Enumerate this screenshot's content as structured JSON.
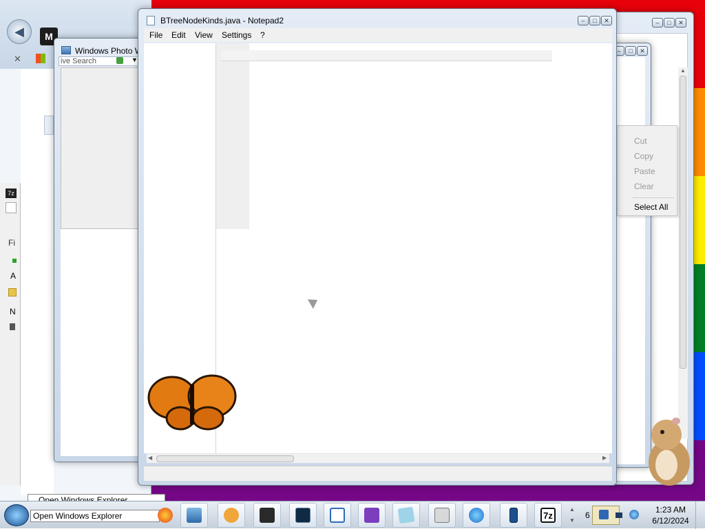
{
  "colors": {
    "wallpaper": [
      "#e8000b",
      "#ff8c00",
      "#ffed00",
      "#008026",
      "#004dff",
      "#750787"
    ],
    "notepad_frame": "#dfe8f3",
    "taskbar": "#d7dfe8"
  },
  "explorer_back_window": {
    "title": "Windows Photo W",
    "search_text": "ive Search"
  },
  "notepad": {
    "title": "BTreeNodeKinds.java - Notepad2",
    "menu": [
      "File",
      "Edit",
      "View",
      "Settings",
      "?"
    ],
    "toolbar_chevron": "»"
  },
  "context_menu": {
    "items": [
      "Cut",
      "Copy",
      "Paste",
      "Clear",
      "Select All"
    ]
  },
  "left_partial_labels": [
    "Fi",
    "A",
    "N"
  ],
  "left_app_badge": "7z",
  "tooltips": {
    "explorer_upper": "Open Windows Explorer",
    "explorer_lower": "Open Windows Explorer"
  },
  "taskbar": {
    "icons": [
      "firefox-icon",
      "photo-viewer-icon",
      "media-player-icon",
      "terminal-icon",
      "monitor-icon",
      "window-icon",
      "visual-studio-icon",
      "notepad-icon",
      "disk-icon",
      "internet-explorer-icon",
      "device-icon",
      "7zip-icon"
    ],
    "seven_zip_label": "7z",
    "tray_number": "6",
    "time": "1:23 AM",
    "date": "6/12/2024"
  }
}
